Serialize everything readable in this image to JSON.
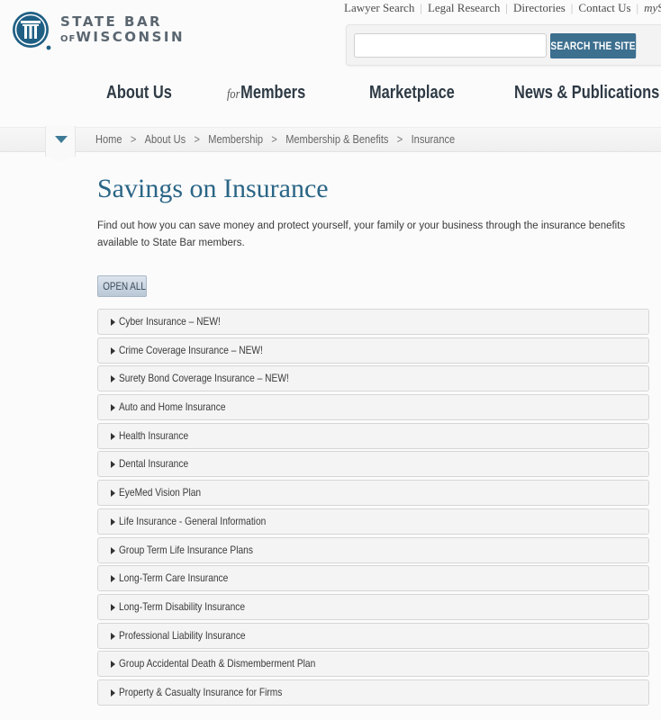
{
  "header": {
    "logo": {
      "line1": "STATE BAR",
      "line2_prefix": "OF",
      "line2": "WISCONSIN",
      "registered": "®",
      "color": "#1f5f84"
    },
    "utility_nav": [
      "Lawyer Search",
      "Legal Research",
      "Directories",
      "Contact Us"
    ],
    "utility_my_prefix": "my",
    "utility_my_rest": "Sta",
    "search": {
      "value": "",
      "placeholder": "",
      "button_label": "SEARCH THE SITE",
      "button_color": "#3d6f8f"
    }
  },
  "main_nav": {
    "about": "About Us",
    "members_prefix": "for",
    "members": "Members",
    "marketplace": "Marketplace",
    "news": "News & Publications"
  },
  "breadcrumb": {
    "toggle_icon": "triangle-down",
    "items": [
      "Home",
      "About Us",
      "Membership",
      "Membership & Benefits",
      "Insurance"
    ],
    "separator": ">"
  },
  "content": {
    "title": "Savings on Insurance",
    "intro": "Find out how you can save money and protect yourself, your family or your business through the insurance benefits available to State Bar members.",
    "open_all_label": "OPEN ALL",
    "accordion": [
      "Cyber Insurance – NEW!",
      "Crime Coverage Insurance – NEW!",
      "Surety Bond Coverage Insurance – NEW!",
      "Auto and Home Insurance",
      "Health Insurance",
      "Dental Insurance",
      "EyeMed Vision Plan",
      "Life Insurance - General Information",
      "Group Term Life Insurance Plans",
      "Long-Term Care Insurance",
      "Long-Term Disability Insurance",
      "Professional Liability Insurance",
      "Group Accidental Death & Dismemberment Plan",
      "Property & Casualty Insurance for Firms"
    ]
  }
}
